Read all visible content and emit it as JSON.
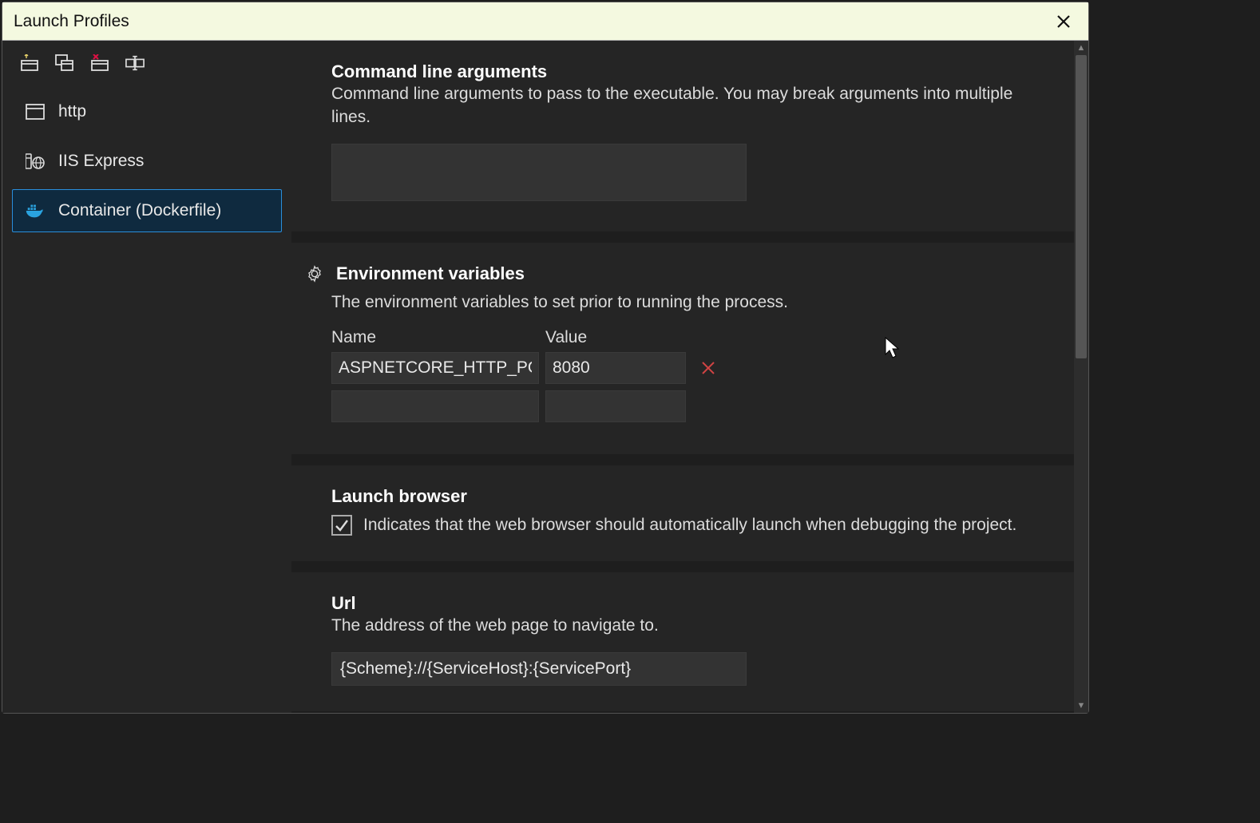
{
  "window": {
    "title": "Launch Profiles"
  },
  "sidebar": {
    "profiles": [
      {
        "label": "http",
        "icon": "window-icon"
      },
      {
        "label": "IIS Express",
        "icon": "globe-icon"
      },
      {
        "label": "Container (Dockerfile)",
        "icon": "docker-icon"
      }
    ],
    "selectedIndex": 2
  },
  "sections": {
    "cmdArgs": {
      "title": "Command line arguments",
      "desc": "Command line arguments to pass to the executable. You may break arguments into multiple lines.",
      "value": ""
    },
    "envVars": {
      "title": "Environment variables",
      "desc": "The environment variables to set prior to running the process.",
      "cols": {
        "name": "Name",
        "value": "Value"
      },
      "rows": [
        {
          "name": "ASPNETCORE_HTTP_PORTS",
          "value": "8080"
        }
      ]
    },
    "launchBrowser": {
      "title": "Launch browser",
      "desc": "Indicates that the web browser should automatically launch when debugging the project.",
      "checked": true
    },
    "url": {
      "title": "Url",
      "desc": "The address of the web page to navigate to.",
      "value": "{Scheme}://{ServiceHost}:{ServicePort}"
    }
  }
}
